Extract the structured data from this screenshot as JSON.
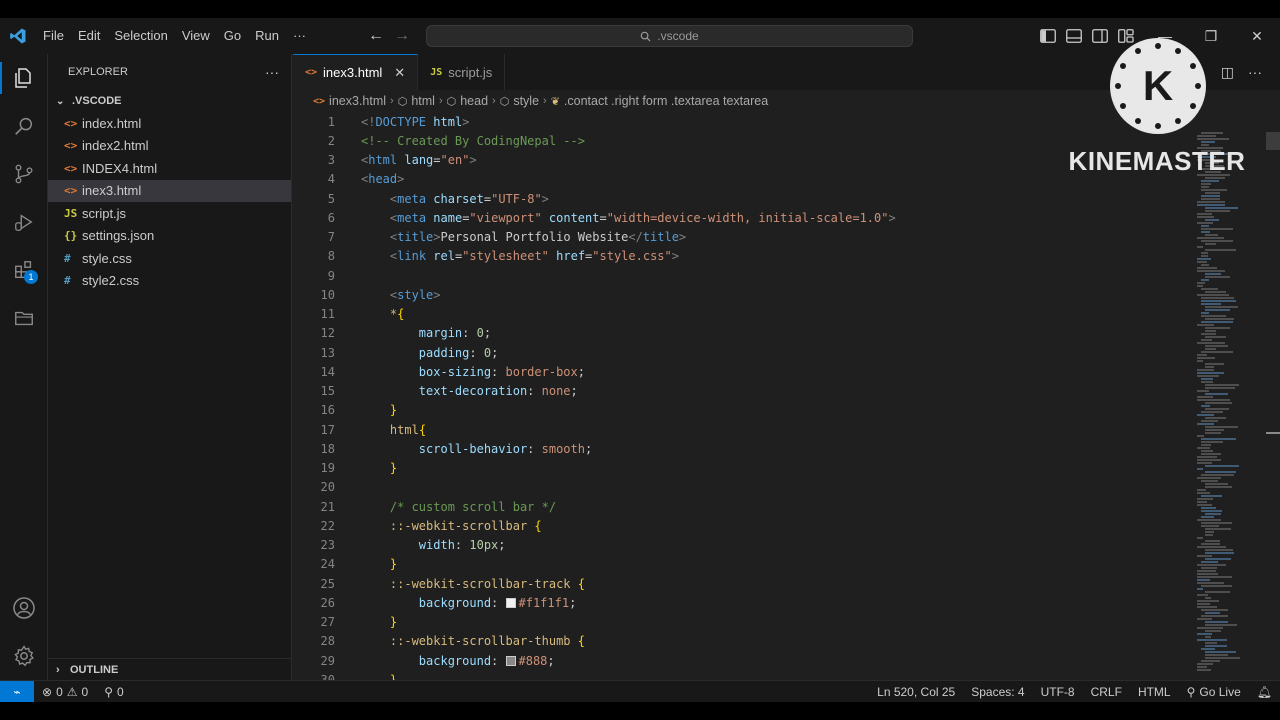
{
  "menu": [
    "File",
    "Edit",
    "Selection",
    "View",
    "Go",
    "Run",
    "···"
  ],
  "search": {
    "text": ".vscode"
  },
  "sidebar": {
    "title": "EXPLORER",
    "more": "···",
    "folder": ".VSCODE",
    "files": [
      {
        "name": "index.html",
        "type": "html",
        "icon": "<>"
      },
      {
        "name": "index2.html",
        "type": "html",
        "icon": "<>"
      },
      {
        "name": "INDEX4.html",
        "type": "html",
        "icon": "<>"
      },
      {
        "name": "inex3.html",
        "type": "html",
        "icon": "<>",
        "selected": true
      },
      {
        "name": "script.js",
        "type": "js",
        "icon": "JS"
      },
      {
        "name": "settings.json",
        "type": "json",
        "icon": "{}"
      },
      {
        "name": "style.css",
        "type": "css",
        "icon": "#"
      },
      {
        "name": "style2.css",
        "type": "css",
        "icon": "#"
      }
    ],
    "outline": "OUTLINE"
  },
  "activity": {
    "extensions_badge": "1"
  },
  "tabs": [
    {
      "label": "inex3.html",
      "icon": "<>",
      "active": true,
      "close": "✕"
    },
    {
      "label": "script.js",
      "icon": "JS",
      "active": false
    }
  ],
  "breadcrumb": [
    "inex3.html",
    "html",
    "head",
    "style",
    ".contact .right form .textarea textarea"
  ],
  "code": [
    {
      "n": "1",
      "t": [
        [
          "t-br",
          "<!"
        ],
        [
          "t-tag",
          "DOCTYPE"
        ],
        [
          "t-def",
          " "
        ],
        [
          "t-attr",
          "html"
        ],
        [
          "t-br",
          ">"
        ]
      ]
    },
    {
      "n": "2",
      "t": [
        [
          "t-com",
          "<!-- Created By CodingNepal -->"
        ]
      ]
    },
    {
      "n": "3",
      "t": [
        [
          "t-br",
          "<"
        ],
        [
          "t-tag",
          "html"
        ],
        [
          "t-def",
          " "
        ],
        [
          "t-attr",
          "lang"
        ],
        [
          "t-def",
          "="
        ],
        [
          "t-str",
          "\"en\""
        ],
        [
          "t-br",
          ">"
        ]
      ]
    },
    {
      "n": "4",
      "t": [
        [
          "t-br",
          "<"
        ],
        [
          "t-tag",
          "head"
        ],
        [
          "t-br",
          ">"
        ]
      ]
    },
    {
      "n": "5",
      "t": [
        [
          "t-def",
          "    "
        ],
        [
          "t-br",
          "<"
        ],
        [
          "t-tag",
          "meta"
        ],
        [
          "t-def",
          " "
        ],
        [
          "t-attr",
          "charset"
        ],
        [
          "t-def",
          "="
        ],
        [
          "t-str",
          "\"UTF-8\""
        ],
        [
          "t-br",
          ">"
        ]
      ]
    },
    {
      "n": "6",
      "t": [
        [
          "t-def",
          "    "
        ],
        [
          "t-br",
          "<"
        ],
        [
          "t-tag",
          "meta"
        ],
        [
          "t-def",
          " "
        ],
        [
          "t-attr",
          "name"
        ],
        [
          "t-def",
          "="
        ],
        [
          "t-str",
          "\"viewport\""
        ],
        [
          "t-def",
          " "
        ],
        [
          "t-attr",
          "content"
        ],
        [
          "t-def",
          "="
        ],
        [
          "t-str",
          "\"width=device-width, initial-scale=1.0\""
        ],
        [
          "t-br",
          ">"
        ]
      ]
    },
    {
      "n": "7",
      "t": [
        [
          "t-def",
          "    "
        ],
        [
          "t-br",
          "<"
        ],
        [
          "t-tag",
          "title"
        ],
        [
          "t-br",
          ">"
        ],
        [
          "t-def",
          "Personal Portfolio Website"
        ],
        [
          "t-br",
          "</"
        ],
        [
          "t-tag",
          "title"
        ],
        [
          "t-br",
          ">"
        ]
      ]
    },
    {
      "n": "8",
      "t": [
        [
          "t-def",
          "    "
        ],
        [
          "t-br",
          "<"
        ],
        [
          "t-tag",
          "link"
        ],
        [
          "t-def",
          " "
        ],
        [
          "t-attr",
          "rel"
        ],
        [
          "t-def",
          "="
        ],
        [
          "t-str",
          "\"stylesheet\""
        ],
        [
          "t-def",
          " "
        ],
        [
          "t-attr",
          "href"
        ],
        [
          "t-def",
          "="
        ],
        [
          "t-str",
          "\"style.css\""
        ],
        [
          "t-br",
          ">"
        ]
      ]
    },
    {
      "n": "9",
      "t": []
    },
    {
      "n": "10",
      "t": [
        [
          "t-def",
          "    "
        ],
        [
          "t-br",
          "<"
        ],
        [
          "t-tag",
          "style"
        ],
        [
          "t-br",
          ">"
        ]
      ]
    },
    {
      "n": "11",
      "t": [
        [
          "t-def",
          "    "
        ],
        [
          "t-sel",
          "*"
        ],
        [
          "t-brace",
          "{"
        ]
      ]
    },
    {
      "n": "12",
      "t": [
        [
          "t-def",
          "        "
        ],
        [
          "t-prop",
          "margin"
        ],
        [
          "t-def",
          ": "
        ],
        [
          "t-num",
          "0"
        ],
        [
          "t-def",
          ";"
        ]
      ]
    },
    {
      "n": "13",
      "t": [
        [
          "t-def",
          "        "
        ],
        [
          "t-prop",
          "padding"
        ],
        [
          "t-def",
          ": "
        ],
        [
          "t-num",
          "0"
        ],
        [
          "t-def",
          ";"
        ]
      ]
    },
    {
      "n": "14",
      "t": [
        [
          "t-def",
          "        "
        ],
        [
          "t-prop",
          "box-sizing"
        ],
        [
          "t-def",
          ": "
        ],
        [
          "t-val",
          "border-box"
        ],
        [
          "t-def",
          ";"
        ]
      ]
    },
    {
      "n": "15",
      "t": [
        [
          "t-def",
          "        "
        ],
        [
          "t-prop",
          "text-decoration"
        ],
        [
          "t-def",
          ": "
        ],
        [
          "t-val",
          "none"
        ],
        [
          "t-def",
          ";"
        ]
      ]
    },
    {
      "n": "16",
      "t": [
        [
          "t-def",
          "    "
        ],
        [
          "t-brace",
          "}"
        ]
      ]
    },
    {
      "n": "17",
      "t": [
        [
          "t-def",
          "    "
        ],
        [
          "t-sel",
          "html"
        ],
        [
          "t-brace",
          "{"
        ]
      ]
    },
    {
      "n": "18",
      "t": [
        [
          "t-def",
          "        "
        ],
        [
          "t-prop",
          "scroll-behavior"
        ],
        [
          "t-def",
          ": "
        ],
        [
          "t-val",
          "smooth"
        ],
        [
          "t-def",
          ";"
        ]
      ]
    },
    {
      "n": "19",
      "t": [
        [
          "t-def",
          "    "
        ],
        [
          "t-brace",
          "}"
        ]
      ]
    },
    {
      "n": "20",
      "t": []
    },
    {
      "n": "21",
      "t": [
        [
          "t-def",
          "    "
        ],
        [
          "t-com",
          "/* custom scroll bar */"
        ]
      ]
    },
    {
      "n": "22",
      "t": [
        [
          "t-def",
          "    "
        ],
        [
          "t-sel",
          "::-webkit-scrollbar"
        ],
        [
          "t-def",
          " "
        ],
        [
          "t-brace",
          "{"
        ]
      ]
    },
    {
      "n": "23",
      "t": [
        [
          "t-def",
          "        "
        ],
        [
          "t-prop",
          "width"
        ],
        [
          "t-def",
          ": "
        ],
        [
          "t-num",
          "10px"
        ],
        [
          "t-def",
          ";"
        ]
      ]
    },
    {
      "n": "24",
      "t": [
        [
          "t-def",
          "    "
        ],
        [
          "t-brace",
          "}"
        ]
      ]
    },
    {
      "n": "25",
      "t": [
        [
          "t-def",
          "    "
        ],
        [
          "t-sel",
          "::-webkit-scrollbar-track"
        ],
        [
          "t-def",
          " "
        ],
        [
          "t-brace",
          "{"
        ]
      ]
    },
    {
      "n": "26",
      "t": [
        [
          "t-def",
          "        "
        ],
        [
          "t-prop",
          "background"
        ],
        [
          "t-def",
          ": "
        ],
        [
          "swatch",
          "#f1f1f1"
        ],
        [
          "t-val",
          "#f1f1f1"
        ],
        [
          "t-def",
          ";"
        ]
      ]
    },
    {
      "n": "27",
      "t": [
        [
          "t-def",
          "    "
        ],
        [
          "t-brace",
          "}"
        ]
      ]
    },
    {
      "n": "28",
      "t": [
        [
          "t-def",
          "    "
        ],
        [
          "t-sel",
          "::-webkit-scrollbar-thumb"
        ],
        [
          "t-def",
          " "
        ],
        [
          "t-brace",
          "{"
        ]
      ]
    },
    {
      "n": "29",
      "t": [
        [
          "t-def",
          "        "
        ],
        [
          "t-prop",
          "background"
        ],
        [
          "t-def",
          ": "
        ],
        [
          "swatch",
          "#888"
        ],
        [
          "t-val",
          "#888"
        ],
        [
          "t-def",
          ";"
        ]
      ]
    },
    {
      "n": "30",
      "t": [
        [
          "t-def",
          "    "
        ],
        [
          "t-brace",
          "}"
        ]
      ]
    }
  ],
  "watermark": {
    "letter": "K",
    "text": "KINEMASTER"
  },
  "status": {
    "errors": "0",
    "warnings": "0",
    "ports": "0",
    "position": "Ln 520, Col 25",
    "spaces": "Spaces: 4",
    "encoding": "UTF-8",
    "eol": "CRLF",
    "language": "HTML",
    "golive": "Go Live"
  },
  "colors": {
    "accent": "#0078d4",
    "background": "#1f1f1f",
    "sidebar": "#181818"
  }
}
